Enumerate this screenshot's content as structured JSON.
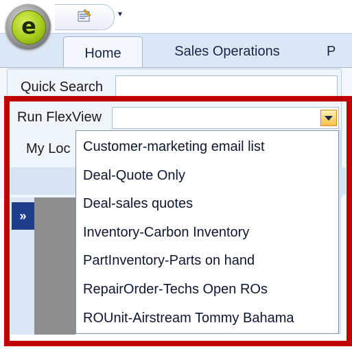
{
  "app": {
    "logo_letter": "e"
  },
  "quick_access": {
    "icon": "properties-icon",
    "menu_arrow": "▾"
  },
  "tabs": [
    {
      "label": "Home",
      "active": true
    },
    {
      "label": "Sales Operations",
      "active": false
    },
    {
      "label": "P",
      "active": false
    }
  ],
  "ribbon": {
    "quick_search_label": "Quick Search",
    "quick_search_value": "",
    "run_flexview_label": "Run FlexView",
    "run_flexview_value": "",
    "my_loc_label": "My Loc"
  },
  "side_panel": {
    "expand_glyph": "»"
  },
  "dropdown": {
    "items": [
      "Customer-marketing email list",
      "Deal-Quote Only",
      "Deal-sales quotes",
      "Inventory-Carbon Inventory",
      "PartInventory-Parts on hand",
      "RepairOrder-Techs Open ROs",
      "ROUnit-Airstream Tommy Bahama"
    ]
  },
  "colors": {
    "highlight": "#c00000",
    "ribbon": "#dce7f5",
    "accent": "#f7c24a"
  }
}
